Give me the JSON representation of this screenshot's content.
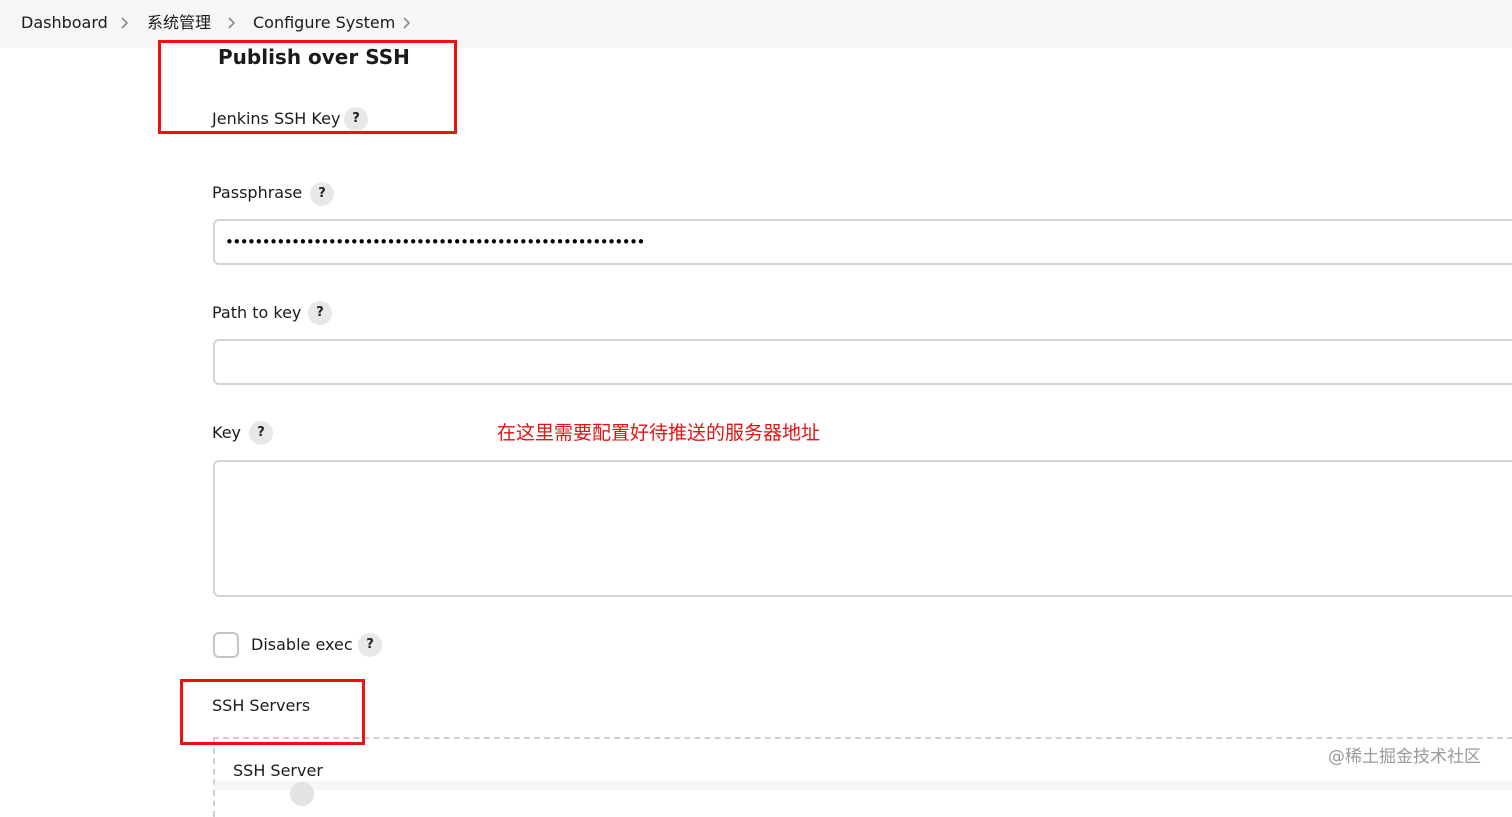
{
  "breadcrumb": {
    "items": [
      "Dashboard",
      "系统管理",
      "Configure System"
    ]
  },
  "section": {
    "title": "Publish over SSH"
  },
  "fields": {
    "jenkins_ssh_key_label": "Jenkins SSH Key",
    "passphrase_label": "Passphrase",
    "passphrase_value": "•••••••••••••••••••••••••••••••••••••••••••••••••••••••••",
    "path_to_key_label": "Path to key",
    "path_to_key_value": "",
    "key_label": "Key",
    "key_value": "",
    "disable_exec_label": "Disable exec",
    "disable_exec_checked": false,
    "help_glyph": "?"
  },
  "ssh_servers": {
    "label": "SSH Servers",
    "server_label": "SSH Server"
  },
  "annotation": {
    "text": "在这里需要配置好待推送的服务器地址",
    "color": "#e41313",
    "box_color": "#ee1111"
  },
  "watermark": "@稀土掘金技术社区",
  "icons": {
    "breadcrumb_separator": "chevron-right-icon",
    "help": "question-mark-icon"
  }
}
